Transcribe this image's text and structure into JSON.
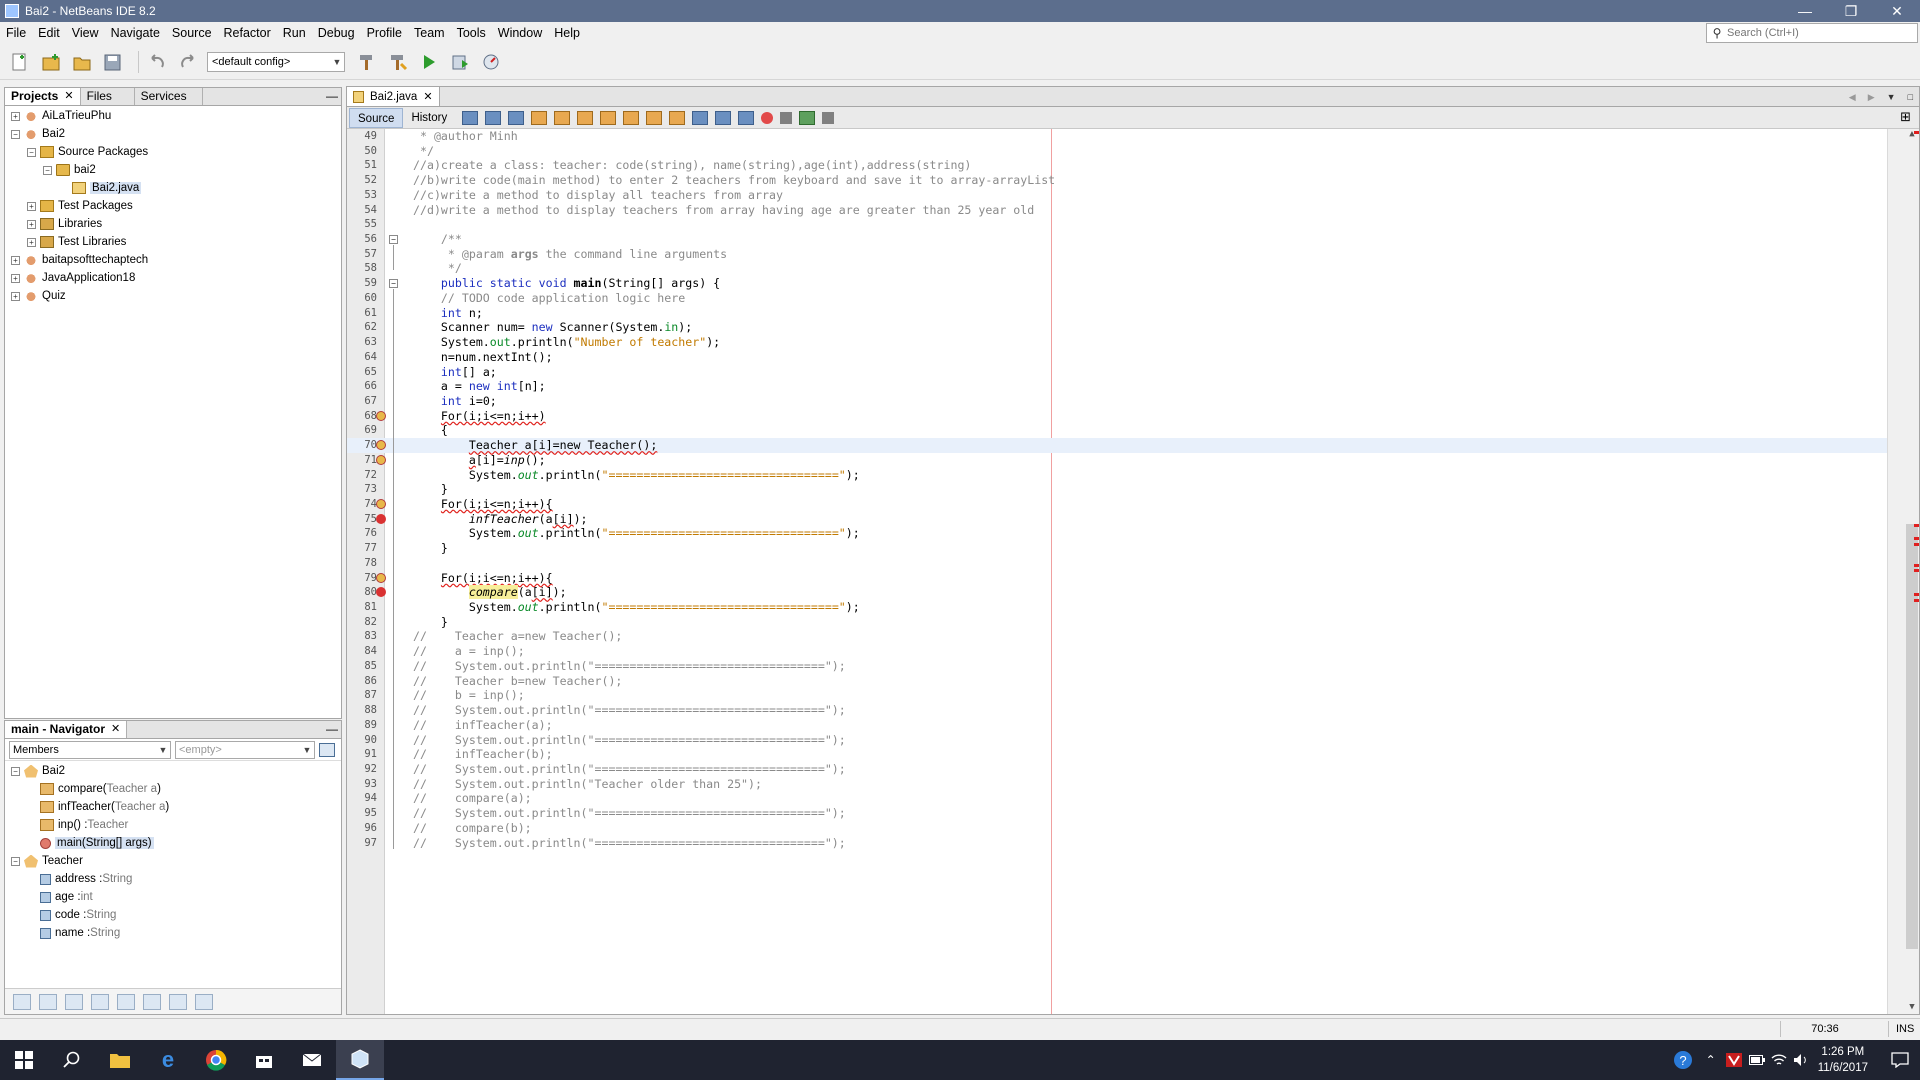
{
  "window": {
    "title": "Bai2 - NetBeans IDE 8.2"
  },
  "menu": [
    "File",
    "Edit",
    "View",
    "Navigate",
    "Source",
    "Refactor",
    "Run",
    "Debug",
    "Profile",
    "Team",
    "Tools",
    "Window",
    "Help"
  ],
  "search": {
    "placeholder": "Search (Ctrl+I)"
  },
  "toolbar": {
    "config": "<default config>"
  },
  "projects_panel": {
    "tabs": [
      "Projects",
      "Files",
      "Services"
    ],
    "tree": [
      {
        "label": "AiLaTrieuPhu",
        "depth": 0,
        "toggle": "+",
        "icon": "project"
      },
      {
        "label": "Bai2",
        "depth": 0,
        "toggle": "-",
        "icon": "project"
      },
      {
        "label": "Source Packages",
        "depth": 1,
        "toggle": "-",
        "icon": "package-root"
      },
      {
        "label": "bai2",
        "depth": 2,
        "toggle": "-",
        "icon": "package"
      },
      {
        "label": "Bai2.java",
        "depth": 3,
        "toggle": "",
        "icon": "java-file",
        "selected": true
      },
      {
        "label": "Test Packages",
        "depth": 1,
        "toggle": "+",
        "icon": "package-root"
      },
      {
        "label": "Libraries",
        "depth": 1,
        "toggle": "+",
        "icon": "library"
      },
      {
        "label": "Test Libraries",
        "depth": 1,
        "toggle": "+",
        "icon": "library"
      },
      {
        "label": "baitapsofttechaptech",
        "depth": 0,
        "toggle": "+",
        "icon": "project"
      },
      {
        "label": "JavaApplication18",
        "depth": 0,
        "toggle": "+",
        "icon": "project"
      },
      {
        "label": "Quiz",
        "depth": 0,
        "toggle": "+",
        "icon": "project"
      }
    ]
  },
  "navigator": {
    "title": "main - Navigator",
    "filter": "Members",
    "empty": "<empty>",
    "tree": [
      {
        "label": "Bai2",
        "type": "",
        "depth": 0,
        "toggle": "-",
        "icon": "class"
      },
      {
        "label": "compare(",
        "type": "Teacher a",
        "suffix": ")",
        "depth": 1,
        "toggle": "",
        "icon": "method"
      },
      {
        "label": "infTeacher(",
        "type": "Teacher a",
        "suffix": ")",
        "depth": 1,
        "toggle": "",
        "icon": "method"
      },
      {
        "label": "inp() : ",
        "type": "Teacher",
        "suffix": "",
        "depth": 1,
        "toggle": "",
        "icon": "method"
      },
      {
        "label": "main(String[] args)",
        "type": "",
        "suffix": "",
        "depth": 1,
        "toggle": "",
        "icon": "main",
        "selected": true
      },
      {
        "label": "Teacher",
        "type": "",
        "depth": 0,
        "toggle": "-",
        "icon": "class"
      },
      {
        "label": "address : ",
        "type": "String",
        "suffix": "",
        "depth": 1,
        "toggle": "",
        "icon": "field"
      },
      {
        "label": "age : ",
        "type": "int",
        "suffix": "",
        "depth": 1,
        "toggle": "",
        "icon": "field"
      },
      {
        "label": "code : ",
        "type": "String",
        "suffix": "",
        "depth": 1,
        "toggle": "",
        "icon": "field"
      },
      {
        "label": "name : ",
        "type": "String",
        "suffix": "",
        "depth": 1,
        "toggle": "",
        "icon": "field"
      }
    ]
  },
  "editor": {
    "tab": "Bai2.java",
    "modes": [
      "Source",
      "History"
    ],
    "active_mode": "Source",
    "lines": [
      {
        "n": 49,
        "segs": [
          [
            "c",
            " * @author Minh"
          ]
        ]
      },
      {
        "n": 50,
        "segs": [
          [
            "c",
            " */"
          ]
        ]
      },
      {
        "n": 51,
        "segs": [
          [
            "c",
            "//a)create a class: teacher: code(string), name(string),age(int),address(string)"
          ]
        ]
      },
      {
        "n": 52,
        "segs": [
          [
            "c",
            "//b)write code(main method) to enter 2 teachers from keyboard and save it to array-arrayList"
          ]
        ]
      },
      {
        "n": 53,
        "segs": [
          [
            "c",
            "//c)write a method to display all teachers from array"
          ]
        ]
      },
      {
        "n": 54,
        "segs": [
          [
            "c",
            "//d)write a method to display teachers from array having age are greater than 25 year old"
          ]
        ]
      },
      {
        "n": 55,
        "segs": []
      },
      {
        "n": 56,
        "fold": "-",
        "segs": [
          [
            "c",
            "    /**"
          ]
        ]
      },
      {
        "n": 57,
        "segs": [
          [
            "c",
            "     * @param "
          ],
          [
            "cb",
            "args"
          ],
          [
            "c",
            " the command line arguments"
          ]
        ]
      },
      {
        "n": 58,
        "segs": [
          [
            "c",
            "     */"
          ]
        ]
      },
      {
        "n": 59,
        "fold": "-",
        "segs": [
          [
            "k",
            "    public static void "
          ],
          [
            "b",
            "main"
          ],
          [
            "t",
            "(String[] args) {"
          ]
        ]
      },
      {
        "n": 60,
        "segs": [
          [
            "c",
            "    // TODO code application logic here"
          ]
        ]
      },
      {
        "n": 61,
        "segs": [
          [
            "k",
            "    int"
          ],
          [
            "t",
            " n;"
          ]
        ]
      },
      {
        "n": 62,
        "segs": [
          [
            "t",
            "    Scanner num= "
          ],
          [
            "k",
            "new"
          ],
          [
            "t",
            " Scanner(System."
          ],
          [
            "f",
            "in"
          ],
          [
            "t",
            ");"
          ]
        ]
      },
      {
        "n": 63,
        "segs": [
          [
            "t",
            "    System."
          ],
          [
            "f",
            "out"
          ],
          [
            "t",
            ".println("
          ],
          [
            "s",
            "\"Number of teacher\""
          ],
          [
            "t",
            ");"
          ]
        ]
      },
      {
        "n": 64,
        "segs": [
          [
            "t",
            "    n=num.nextInt();"
          ]
        ]
      },
      {
        "n": 65,
        "segs": [
          [
            "k",
            "    int"
          ],
          [
            "t",
            "[] a;"
          ]
        ]
      },
      {
        "n": 66,
        "segs": [
          [
            "t",
            "    a = "
          ],
          [
            "k",
            "new int"
          ],
          [
            "t",
            "[n];"
          ]
        ]
      },
      {
        "n": 67,
        "segs": [
          [
            "k",
            "    int"
          ],
          [
            "t",
            " i=0;"
          ]
        ]
      },
      {
        "n": 68,
        "mark": "bulb",
        "segs": [
          [
            "t",
            "    "
          ],
          [
            "e",
            "For(i;i<=n;i++)"
          ]
        ]
      },
      {
        "n": 69,
        "segs": [
          [
            "t",
            "    {"
          ]
        ]
      },
      {
        "n": 70,
        "mark": "bulb",
        "current": true,
        "segs": [
          [
            "t",
            "        "
          ],
          [
            "e",
            "Teacher a[i]=new Teacher();"
          ]
        ]
      },
      {
        "n": 71,
        "mark": "bulb",
        "segs": [
          [
            "t",
            "        "
          ],
          [
            "e",
            "a"
          ],
          [
            "t",
            "[i]="
          ],
          [
            "i",
            "inp"
          ],
          [
            "t",
            "();"
          ]
        ]
      },
      {
        "n": 72,
        "segs": [
          [
            "t",
            "        System."
          ],
          [
            "fi",
            "out"
          ],
          [
            "t",
            ".println("
          ],
          [
            "s",
            "\"=================================\""
          ],
          [
            "t",
            ");"
          ]
        ]
      },
      {
        "n": 73,
        "segs": [
          [
            "t",
            "    }"
          ]
        ]
      },
      {
        "n": 74,
        "mark": "bulb",
        "segs": [
          [
            "t",
            "    "
          ],
          [
            "e",
            "For(i;i<=n;i++){"
          ]
        ]
      },
      {
        "n": 75,
        "mark": "error",
        "segs": [
          [
            "t",
            "        "
          ],
          [
            "i",
            "infTeacher"
          ],
          [
            "t",
            "(a"
          ],
          [
            "e",
            "[i]"
          ],
          [
            "t",
            ");"
          ]
        ]
      },
      {
        "n": 76,
        "segs": [
          [
            "t",
            "        System."
          ],
          [
            "fi",
            "out"
          ],
          [
            "t",
            ".println("
          ],
          [
            "s",
            "\"=================================\""
          ],
          [
            "t",
            ");"
          ]
        ]
      },
      {
        "n": 77,
        "segs": [
          [
            "t",
            "    }"
          ]
        ]
      },
      {
        "n": 78,
        "segs": []
      },
      {
        "n": 79,
        "mark": "bulb",
        "segs": [
          [
            "t",
            "    "
          ],
          [
            "e",
            "For(i;i<=n;i++){"
          ]
        ]
      },
      {
        "n": 80,
        "mark": "error",
        "segs": [
          [
            "t",
            "        "
          ],
          [
            "h",
            "compare"
          ],
          [
            "t",
            "(a"
          ],
          [
            "e",
            "[i]"
          ],
          [
            "t",
            ");"
          ]
        ]
      },
      {
        "n": 81,
        "segs": [
          [
            "t",
            "        System."
          ],
          [
            "fi",
            "out"
          ],
          [
            "t",
            ".println("
          ],
          [
            "s",
            "\"=================================\""
          ],
          [
            "t",
            ");"
          ]
        ]
      },
      {
        "n": 82,
        "segs": [
          [
            "t",
            "    }"
          ]
        ]
      },
      {
        "n": 83,
        "segs": [
          [
            "c",
            "//    Teacher a=new Teacher();"
          ]
        ]
      },
      {
        "n": 84,
        "segs": [
          [
            "c",
            "//    a = inp();"
          ]
        ]
      },
      {
        "n": 85,
        "segs": [
          [
            "c",
            "//    System.out.println(\"=================================\");"
          ]
        ]
      },
      {
        "n": 86,
        "segs": [
          [
            "c",
            "//    Teacher b=new Teacher();"
          ]
        ]
      },
      {
        "n": 87,
        "segs": [
          [
            "c",
            "//    b = inp();"
          ]
        ]
      },
      {
        "n": 88,
        "segs": [
          [
            "c",
            "//    System.out.println(\"=================================\");"
          ]
        ]
      },
      {
        "n": 89,
        "segs": [
          [
            "c",
            "//    infTeacher(a);"
          ]
        ]
      },
      {
        "n": 90,
        "segs": [
          [
            "c",
            "//    System.out.println(\"=================================\");"
          ]
        ]
      },
      {
        "n": 91,
        "segs": [
          [
            "c",
            "//    infTeacher(b);"
          ]
        ]
      },
      {
        "n": 92,
        "segs": [
          [
            "c",
            "//    System.out.println(\"=================================\");"
          ]
        ]
      },
      {
        "n": 93,
        "segs": [
          [
            "c",
            "//    System.out.println(\"Teacher older than 25\");"
          ]
        ]
      },
      {
        "n": 94,
        "segs": [
          [
            "c",
            "//    compare(a);"
          ]
        ]
      },
      {
        "n": 95,
        "segs": [
          [
            "c",
            "//    System.out.println(\"=================================\");"
          ]
        ]
      },
      {
        "n": 96,
        "segs": [
          [
            "c",
            "//    compare(b);"
          ]
        ]
      },
      {
        "n": 97,
        "segs": [
          [
            "c",
            "//    System.out.println(\"=================================\");"
          ]
        ]
      }
    ]
  },
  "status": {
    "position": "70:36",
    "mode": "INS"
  },
  "taskbar": {
    "time": "1:26 PM",
    "date": "11/6/2017"
  }
}
